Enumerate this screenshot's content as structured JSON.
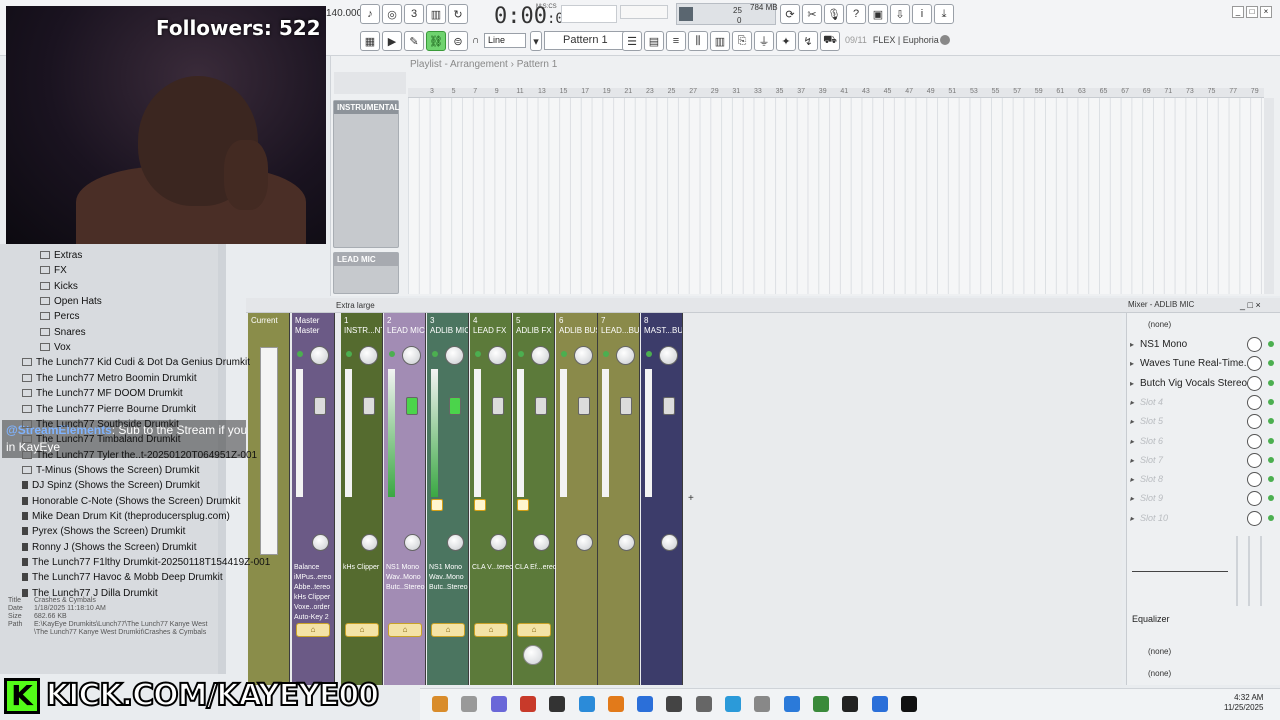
{
  "stream": {
    "followers": "Followers: 522",
    "chat_user": "@StreamElements",
    "chat_msg": ": Sub to the Stream if you believe in KayEye",
    "kick_url": "KICK.COM/KAYEYE00",
    "kick_logo": "K"
  },
  "toolbar": {
    "tempo": "140.000",
    "time": "0:00",
    "time_sub": ":00",
    "time_unit": "M:S:CS",
    "cpu_a": "25",
    "cpu_b": "0",
    "mem": "784 MB",
    "snap": "Line",
    "pattern": "Pattern 1",
    "hint_num": "09/11",
    "hint_text": "FLEX | Euphoria"
  },
  "playlist": {
    "title": "Playlist - Arrangement › Pattern 1",
    "ruler": [
      "3",
      "5",
      "7",
      "9",
      "11",
      "13",
      "15",
      "17",
      "19",
      "21",
      "23",
      "25",
      "27",
      "29",
      "31",
      "33",
      "35",
      "37",
      "39",
      "41",
      "43",
      "45",
      "47",
      "49",
      "51",
      "53",
      "55",
      "57",
      "59",
      "61",
      "63",
      "65",
      "67",
      "69",
      "71",
      "73",
      "75",
      "77",
      "79"
    ],
    "tracks": [
      "INSTRUMENTAL",
      "LEAD MIC"
    ]
  },
  "browser": {
    "items": [
      {
        "label": "Extras",
        "type": "folder"
      },
      {
        "label": "FX",
        "type": "folder"
      },
      {
        "label": "Kicks",
        "type": "folder"
      },
      {
        "label": "Open Hats",
        "type": "folder"
      },
      {
        "label": "Percs",
        "type": "folder"
      },
      {
        "label": "Snares",
        "type": "folder"
      },
      {
        "label": "Vox",
        "type": "folder"
      },
      {
        "label": "The Lunch77 Kid Cudi & Dot Da Genius Drumkit",
        "type": "folder"
      },
      {
        "label": "The Lunch77 Metro Boomin Drumkit",
        "type": "folder"
      },
      {
        "label": "The Lunch77 MF DOOM Drumkit",
        "type": "folder"
      },
      {
        "label": "The Lunch77 Pierre Bourne Drumkit",
        "type": "folder"
      },
      {
        "label": "The Lunch77 Southside Drumkit",
        "type": "folder"
      },
      {
        "label": "The Lunch77 Timbaland Drumkit",
        "type": "folder"
      },
      {
        "label": "The Lunch77 Tyler the..t-20250120T064951Z-001",
        "type": "folder"
      },
      {
        "label": "T-Minus (Shows the Screen) Drumkit",
        "type": "folder"
      },
      {
        "label": "DJ Spinz (Shows the Screen) Drumkit",
        "type": "file"
      },
      {
        "label": "Honorable C-Note (Shows the Screen) Drumkit",
        "type": "file"
      },
      {
        "label": "Mike Dean Drum Kit (theproducersplug.com)",
        "type": "file"
      },
      {
        "label": "Pyrex (Shows the Screen) Drumkit",
        "type": "file"
      },
      {
        "label": "Ronny J (Shows the Screen) Drumkit",
        "type": "file"
      },
      {
        "label": "The Lunch77 F1lthy Drumkit-20250118T154419Z-001",
        "type": "file"
      },
      {
        "label": "The Lunch77 Havoc & Mobb Deep Drumkit",
        "type": "file"
      },
      {
        "label": "The Lunch77 J Dilla Drumkit",
        "type": "file"
      }
    ],
    "info": {
      "title_k": "Title",
      "title_v": "Crashes & Cymbals",
      "date_k": "Date",
      "date_v": "1/18/2025 11:18:10 AM",
      "size_k": "Size",
      "size_v": "682.66 KB",
      "path_k": "Path",
      "path_v": "E:\\KayEye Drumkits\\Lunch77\\The Lunch77 Kanye West\\The Lunch77 Kanye West Drumkit\\Crashes & Cymbals"
    }
  },
  "mixer": {
    "size": "Extra large",
    "title": "Mixer - ADLIB MIC",
    "current": "Current",
    "strips": [
      {
        "num": "",
        "name": "Master",
        "sub": "Master",
        "color": "#6b5a86",
        "fx": "Balance\niMPus..ereo\nAbbe..tereo\nkHs Clipper\nVoxe..order\nAuto-Key 2"
      },
      {
        "num": "1",
        "name": "INSTR...NTAL",
        "color": "#556b2f",
        "fx": "kHs Clipper"
      },
      {
        "num": "2",
        "name": "LEAD MIC",
        "color": "#a28cb4",
        "fx": "NS1 Mono\nWav..Mono\nButc..Stereo"
      },
      {
        "num": "3",
        "name": "ADLIB MIC",
        "color": "#4b7560",
        "fx": "NS1 Mono\nWav..Mono\nButc..Stereo"
      },
      {
        "num": "4",
        "name": "LEAD FX",
        "color": "#5c7a3a",
        "fx": "CLA V...tereo"
      },
      {
        "num": "5",
        "name": "ADLIB FX",
        "color": "#5c7a3a",
        "fx": "CLA Ef...ereo"
      },
      {
        "num": "6",
        "name": "ADLIB BUS",
        "color": "#8a8a4a",
        "fx": ""
      },
      {
        "num": "7",
        "name": "LEAD...BUS",
        "color": "#8a8a4a",
        "fx": ""
      },
      {
        "num": "8",
        "name": "MAST...BUS",
        "color": "#3c3c6a",
        "fx": ""
      }
    ]
  },
  "fxpanel": {
    "input": "(none)",
    "slots": [
      "NS1 Mono",
      "Waves Tune Real-Time...",
      "Butch Vig Vocals Stereo",
      "Slot 4",
      "Slot 5",
      "Slot 6",
      "Slot 7",
      "Slot 8",
      "Slot 9",
      "Slot 10"
    ],
    "eq": "Equalizer",
    "out1": "(none)",
    "out2": "(none)"
  },
  "taskbar": {
    "time": "4:32 AM",
    "date": "11/25/2025"
  }
}
